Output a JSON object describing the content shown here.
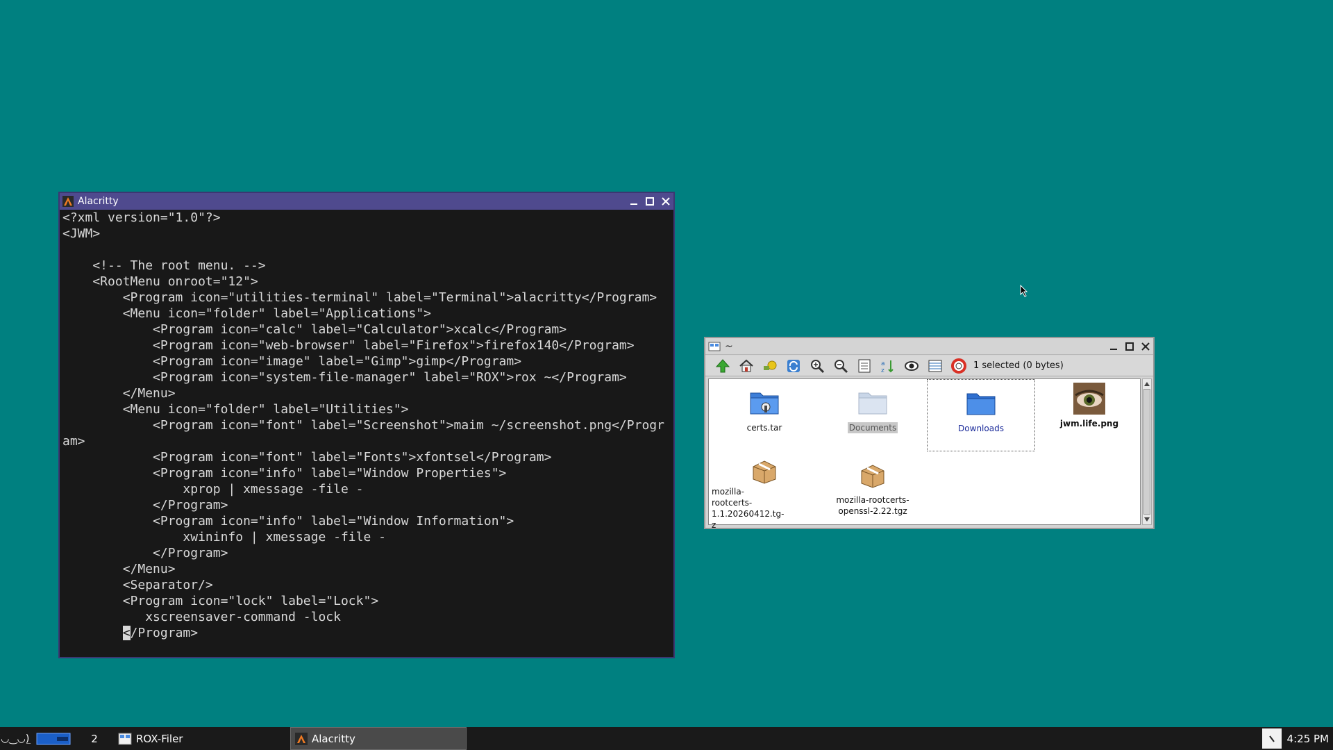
{
  "desktop": {
    "background": "#008080"
  },
  "alacritty": {
    "title": "Alacritty",
    "colors": {
      "frame": "#4f4a8e",
      "bg": "#181818",
      "fg": "#d8d8d8"
    },
    "lines": [
      "<?xml version=\"1.0\"?>",
      "<JWM>",
      "",
      "    <!-- The root menu. -->",
      "    <RootMenu onroot=\"12\">",
      "        <Program icon=\"utilities-terminal\" label=\"Terminal\">alacritty</Program>",
      "        <Menu icon=\"folder\" label=\"Applications\">",
      "            <Program icon=\"calc\" label=\"Calculator\">xcalc</Program>",
      "            <Program icon=\"web-browser\" label=\"Firefox\">firefox140</Program>",
      "            <Program icon=\"image\" label=\"Gimp\">gimp</Program>",
      "            <Program icon=\"system-file-manager\" label=\"ROX\">rox ~</Program>",
      "        </Menu>",
      "        <Menu icon=\"folder\" label=\"Utilities\">",
      "            <Program icon=\"font\" label=\"Screenshot\">maim ~/screenshot.png</Progr",
      "am>",
      "            <Program icon=\"font\" label=\"Fonts\">xfontsel</Program>",
      "            <Program icon=\"info\" label=\"Window Properties\">",
      "                xprop | xmessage -file -",
      "            </Program>",
      "            <Program icon=\"info\" label=\"Window Information\">",
      "                xwininfo | xmessage -file -",
      "            </Program>",
      "        </Menu>",
      "        <Separator/>",
      "        <Program icon=\"lock\" label=\"Lock\">",
      "           xscreensaver-command -lock"
    ],
    "cursor_line": {
      "indent": "        ",
      "cursor_char": "<",
      "rest": "/Program>"
    }
  },
  "rox": {
    "title": "~",
    "status": "1 selected (0 bytes)",
    "toolbar": [
      "up-icon",
      "home-icon",
      "bookmarks-icon",
      "refresh-icon",
      "zoom-in-icon",
      "zoom-out-icon",
      "details-icon",
      "sort-icon",
      "show-hidden-icon",
      "select-icon",
      "help-icon"
    ],
    "files": [
      {
        "name": "certs.tar",
        "icon": "archive-folder-icon",
        "bold": false,
        "selected": false
      },
      {
        "name": "Documents",
        "icon": "folder-icon",
        "bold": false,
        "selected": false,
        "dim": true
      },
      {
        "name": "Downloads",
        "icon": "folder-icon",
        "bold": false,
        "selected": true
      },
      {
        "name": "jwm.life.png",
        "icon": "image-thumbnail-icon",
        "bold": true,
        "selected": false
      },
      {
        "name": "mozilla-rootcerts-1.1.20260412.tgz",
        "line1": "mozilla-",
        "line2": "rootcerts-1.1.20260412.tg-",
        "line3": "z",
        "icon": "package-icon"
      },
      {
        "name": "mozilla-rootcerts-openssl-2.22.tgz",
        "line1": "mozilla-rootcerts-",
        "line2": "openssl-2.22.tgz",
        "icon": "package-icon"
      }
    ]
  },
  "taskbar": {
    "menu_label": "(◡‿◡)",
    "desktop_number": "2",
    "tasks": [
      {
        "label": "ROX-Filer",
        "icon": "rox-icon",
        "active": false
      },
      {
        "label": "Alacritty",
        "icon": "alacritty-icon",
        "active": true
      }
    ],
    "clock": "4:25 PM"
  }
}
